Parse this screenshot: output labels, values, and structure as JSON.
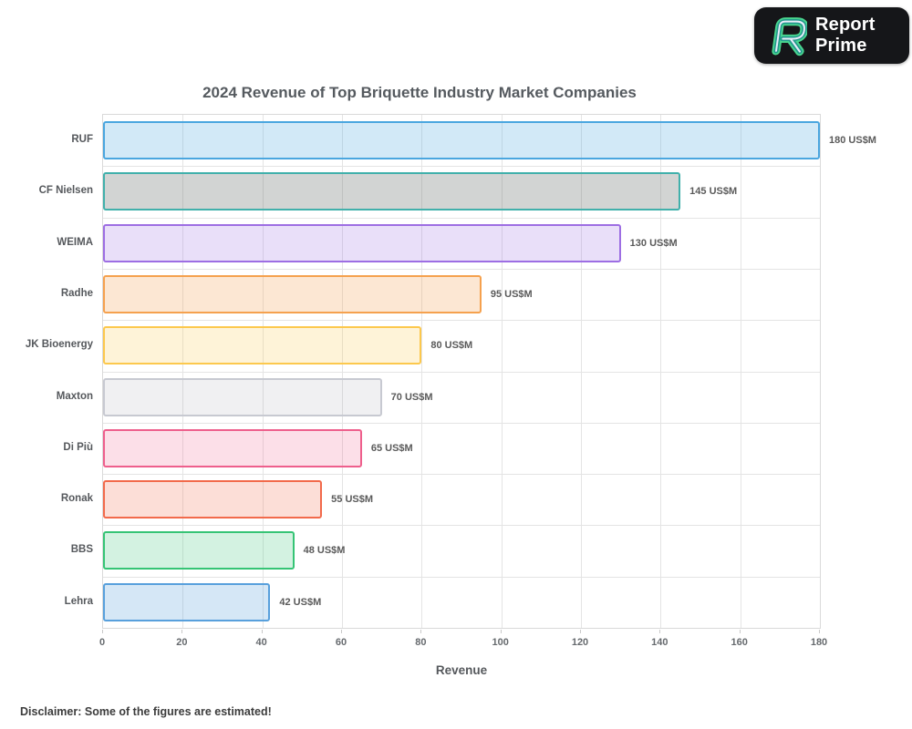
{
  "logo": {
    "brand_line1": "Report",
    "brand_line2": "Prime",
    "bg_color": "#151619",
    "icon": {
      "name": "report-prime-r-icon",
      "outer_color": "#49d68f",
      "middle_color": "#23998c",
      "inner_color": "#e9ecfa"
    }
  },
  "title": "2024 Revenue of Top Briquette Industry Market Companies",
  "chart_data": {
    "type": "bar",
    "orientation": "horizontal",
    "title": "2024 Revenue of Top Briquette Industry Market Companies",
    "xlabel": "Revenue",
    "ylabel": "",
    "unit": "US$M",
    "xlim": [
      0,
      180
    ],
    "xticks": [
      0,
      20,
      40,
      60,
      80,
      100,
      120,
      140,
      160,
      180
    ],
    "grid": true,
    "legend": "none",
    "categories": [
      "RUF",
      "CF Nielsen",
      "WEIMA",
      "Radhe",
      "JK Bioenergy",
      "Maxton",
      "Di Più",
      "Ronak",
      "BBS",
      "Lehra"
    ],
    "values": [
      180,
      145,
      130,
      95,
      80,
      70,
      65,
      55,
      48,
      42
    ],
    "value_labels": [
      "180 US$M",
      "145 US$M",
      "130 US$M",
      "95 US$M",
      "80 US$M",
      "70 US$M",
      "65 US$M",
      "55 US$M",
      "48 US$M",
      "42 US$M"
    ],
    "bar_styles": [
      {
        "border": "#4aa6df",
        "fill": "rgba(74,166,223,0.25)"
      },
      {
        "border": "#41b0ab",
        "fill": "rgba(105,112,108,0.30)"
      },
      {
        "border": "#9d6ee3",
        "fill": "rgba(157,110,227,0.22)"
      },
      {
        "border": "#f5a14e",
        "fill": "rgba(245,161,78,0.25)"
      },
      {
        "border": "#fcc84d",
        "fill": "rgba(252,200,77,0.22)"
      },
      {
        "border": "#c7c9d1",
        "fill": "rgba(150,152,160,0.14)"
      },
      {
        "border": "#ee5f8c",
        "fill": "rgba(238,95,140,0.20)"
      },
      {
        "border": "#f26a4b",
        "fill": "rgba(242,106,75,0.22)"
      },
      {
        "border": "#35c475",
        "fill": "rgba(53,196,117,0.22)"
      },
      {
        "border": "#58a0dc",
        "fill": "rgba(88,160,220,0.25)"
      }
    ]
  },
  "footer": {
    "disclaimer": "Disclaimer: Some of the figures are estimated!"
  }
}
